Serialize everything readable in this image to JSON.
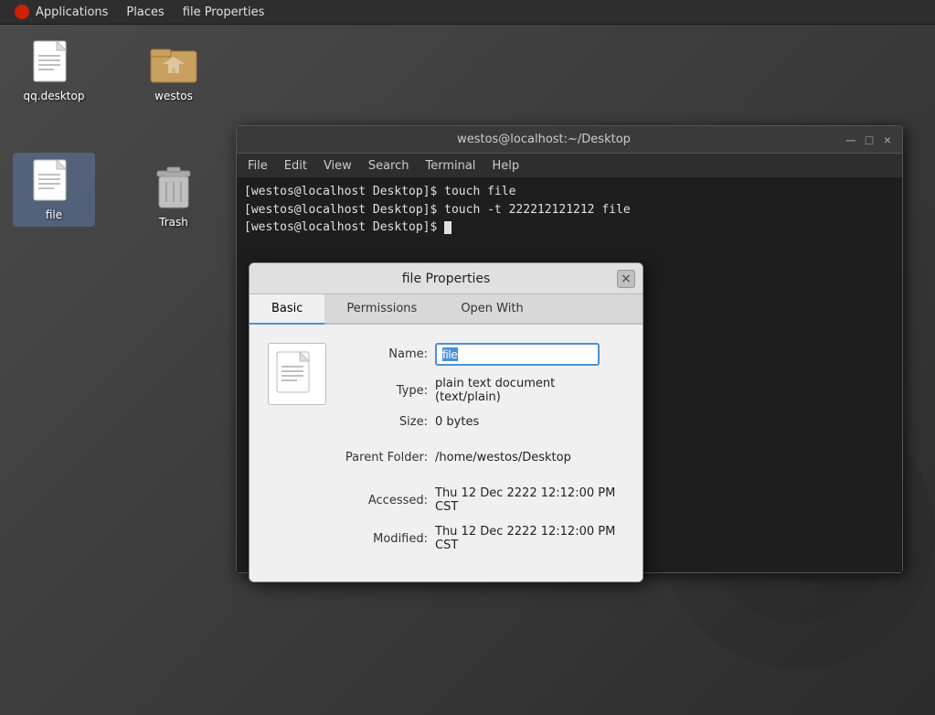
{
  "topbar": {
    "app_label": "Applications",
    "places_label": "Places",
    "fileprop_label": "file Properties"
  },
  "desktop": {
    "icons": [
      {
        "id": "qq-desktop",
        "label": "qq.desktop",
        "type": "textfile"
      },
      {
        "id": "westos",
        "label": "westos",
        "type": "folder"
      },
      {
        "id": "file",
        "label": "file",
        "type": "textfile",
        "selected": true
      },
      {
        "id": "trash",
        "label": "Trash",
        "type": "trash"
      }
    ]
  },
  "terminal": {
    "title": "westos@localhost:~/Desktop",
    "lines": [
      "[westos@localhost Desktop]$ touch file",
      "[westos@localhost Desktop]$ touch -t 222212121212 file",
      "[westos@localhost Desktop]$ "
    ],
    "menu": [
      "File",
      "Edit",
      "View",
      "Search",
      "Terminal",
      "Help"
    ],
    "buttons": [
      "─",
      "□",
      "×"
    ]
  },
  "file_properties": {
    "title": "file Properties",
    "close_label": "×",
    "tabs": [
      {
        "id": "basic",
        "label": "Basic",
        "active": true
      },
      {
        "id": "permissions",
        "label": "Permissions",
        "active": false
      },
      {
        "id": "open-with",
        "label": "Open With",
        "active": false
      }
    ],
    "fields": {
      "name_label": "Name:",
      "name_value": "file",
      "type_label": "Type:",
      "type_value": "plain text document (text/plain)",
      "size_label": "Size:",
      "size_value": "0 bytes",
      "parent_folder_label": "Parent Folder:",
      "parent_folder_value": "/home/westos/Desktop",
      "accessed_label": "Accessed:",
      "accessed_value": "Thu 12 Dec 2222 12:12:00 PM CST",
      "modified_label": "Modified:",
      "modified_value": "Thu 12 Dec 2222 12:12:00 PM CST"
    }
  }
}
